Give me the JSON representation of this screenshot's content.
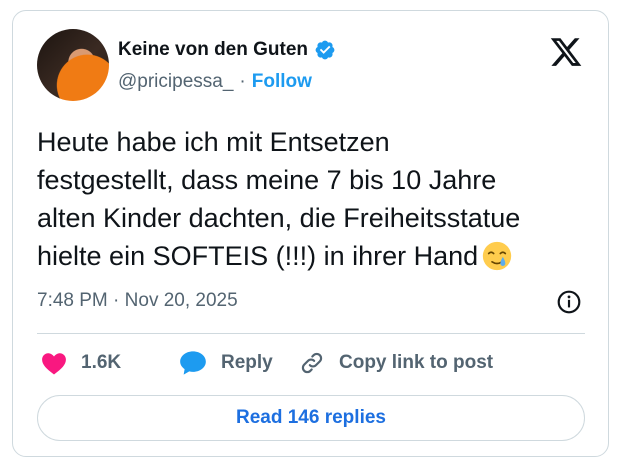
{
  "author": {
    "display_name": "Keine von den Guten",
    "handle": "@pricipessa_",
    "separator": "·",
    "follow_label": "Follow"
  },
  "tweet": {
    "text": "Heute habe ich mit Entsetzen\nfestgestellt, dass meine 7 bis 10 Jahre\nalten Kinder dachten, die Freiheitsstatue\nhielte ein SOFTEIS (!!!) in ihrer Hand",
    "emoji": "face-holding-back-tears-icon",
    "time": "7:48 PM",
    "date_separator": "·",
    "date": "Nov 20, 2025"
  },
  "actions": {
    "likes": "1.6K",
    "reply_label": "Reply",
    "copy_label": "Copy link to post"
  },
  "read_replies_label": "Read 146 replies",
  "colors": {
    "accent": "#1d9bf0",
    "heart": "#f91880",
    "secondary_text": "#536471",
    "border": "#cfd9de"
  }
}
